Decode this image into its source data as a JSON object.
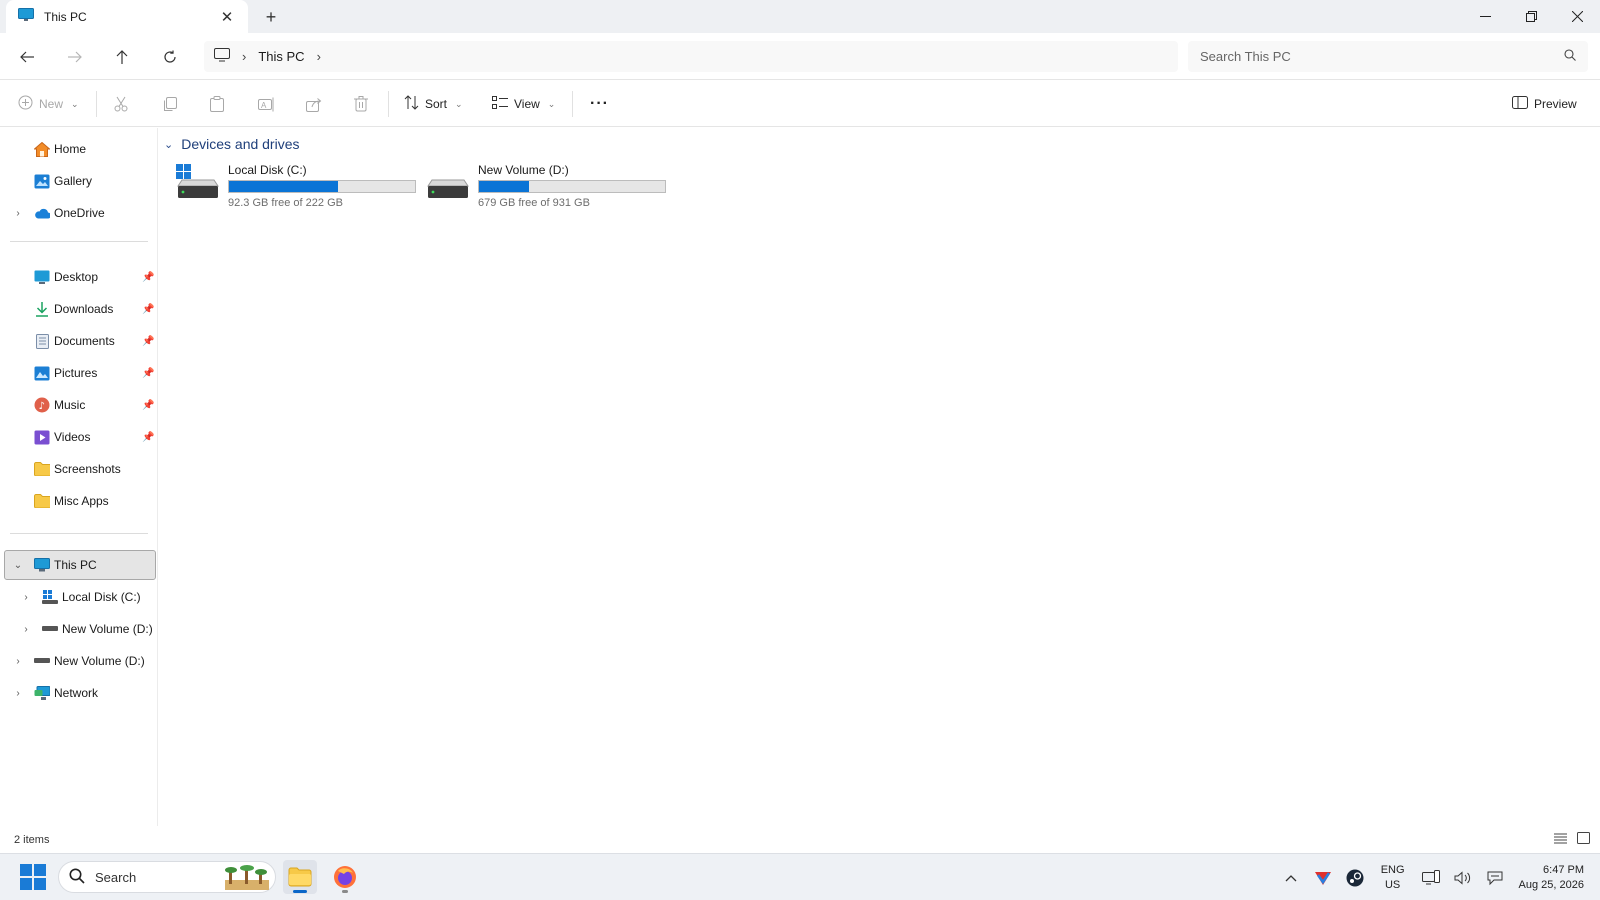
{
  "window": {
    "tab_title": "This PC",
    "tab_close": "✕",
    "new_tab": "+"
  },
  "address": {
    "breadcrumb": [
      "This PC"
    ],
    "search_placeholder": "Search This PC"
  },
  "commands": {
    "new_label": "New",
    "sort_label": "Sort",
    "view_label": "View",
    "more_label": "···",
    "preview_label": "Preview"
  },
  "sidebar": {
    "quick": [
      {
        "label": "Home",
        "icon": "home-icon"
      },
      {
        "label": "Gallery",
        "icon": "gallery-icon"
      },
      {
        "label": "OneDrive",
        "icon": "onedrive-icon"
      }
    ],
    "pinned": [
      {
        "label": "Desktop",
        "icon": "desktop-folder-icon"
      },
      {
        "label": "Downloads",
        "icon": "downloads-icon"
      },
      {
        "label": "Documents",
        "icon": "documents-icon"
      },
      {
        "label": "Pictures",
        "icon": "pictures-icon"
      },
      {
        "label": "Music",
        "icon": "music-icon"
      },
      {
        "label": "Videos",
        "icon": "videos-icon"
      },
      {
        "label": "Screenshots",
        "icon": "folder-icon"
      },
      {
        "label": "Misc Apps",
        "icon": "folder-icon"
      }
    ],
    "tree": [
      {
        "label": "This PC",
        "icon": "this-pc-icon"
      },
      {
        "label": "Local Disk (C:)",
        "icon": "windows-drive-icon"
      },
      {
        "label": "New Volume (D:)",
        "icon": "drive-icon"
      },
      {
        "label": "New Volume (D:)",
        "icon": "drive-icon"
      },
      {
        "label": "Network",
        "icon": "network-icon"
      }
    ]
  },
  "content": {
    "group_title": "Devices and drives",
    "drives": [
      {
        "name": "Local Disk (C:)",
        "free_text": "92.3 GB free of 222 GB",
        "used_fraction": 0.584
      },
      {
        "name": "New Volume (D:)",
        "free_text": "679 GB free of 931 GB",
        "used_fraction": 0.271
      }
    ]
  },
  "status": {
    "item_count": "2 items"
  },
  "taskbar": {
    "search_label": "Search",
    "lang_top": "ENG",
    "lang_bottom": "US",
    "time": "6:47 PM",
    "date": "Aug 25, 2026"
  },
  "colors": {
    "accent": "#0a74d6",
    "group_header": "#1f3f7a"
  }
}
